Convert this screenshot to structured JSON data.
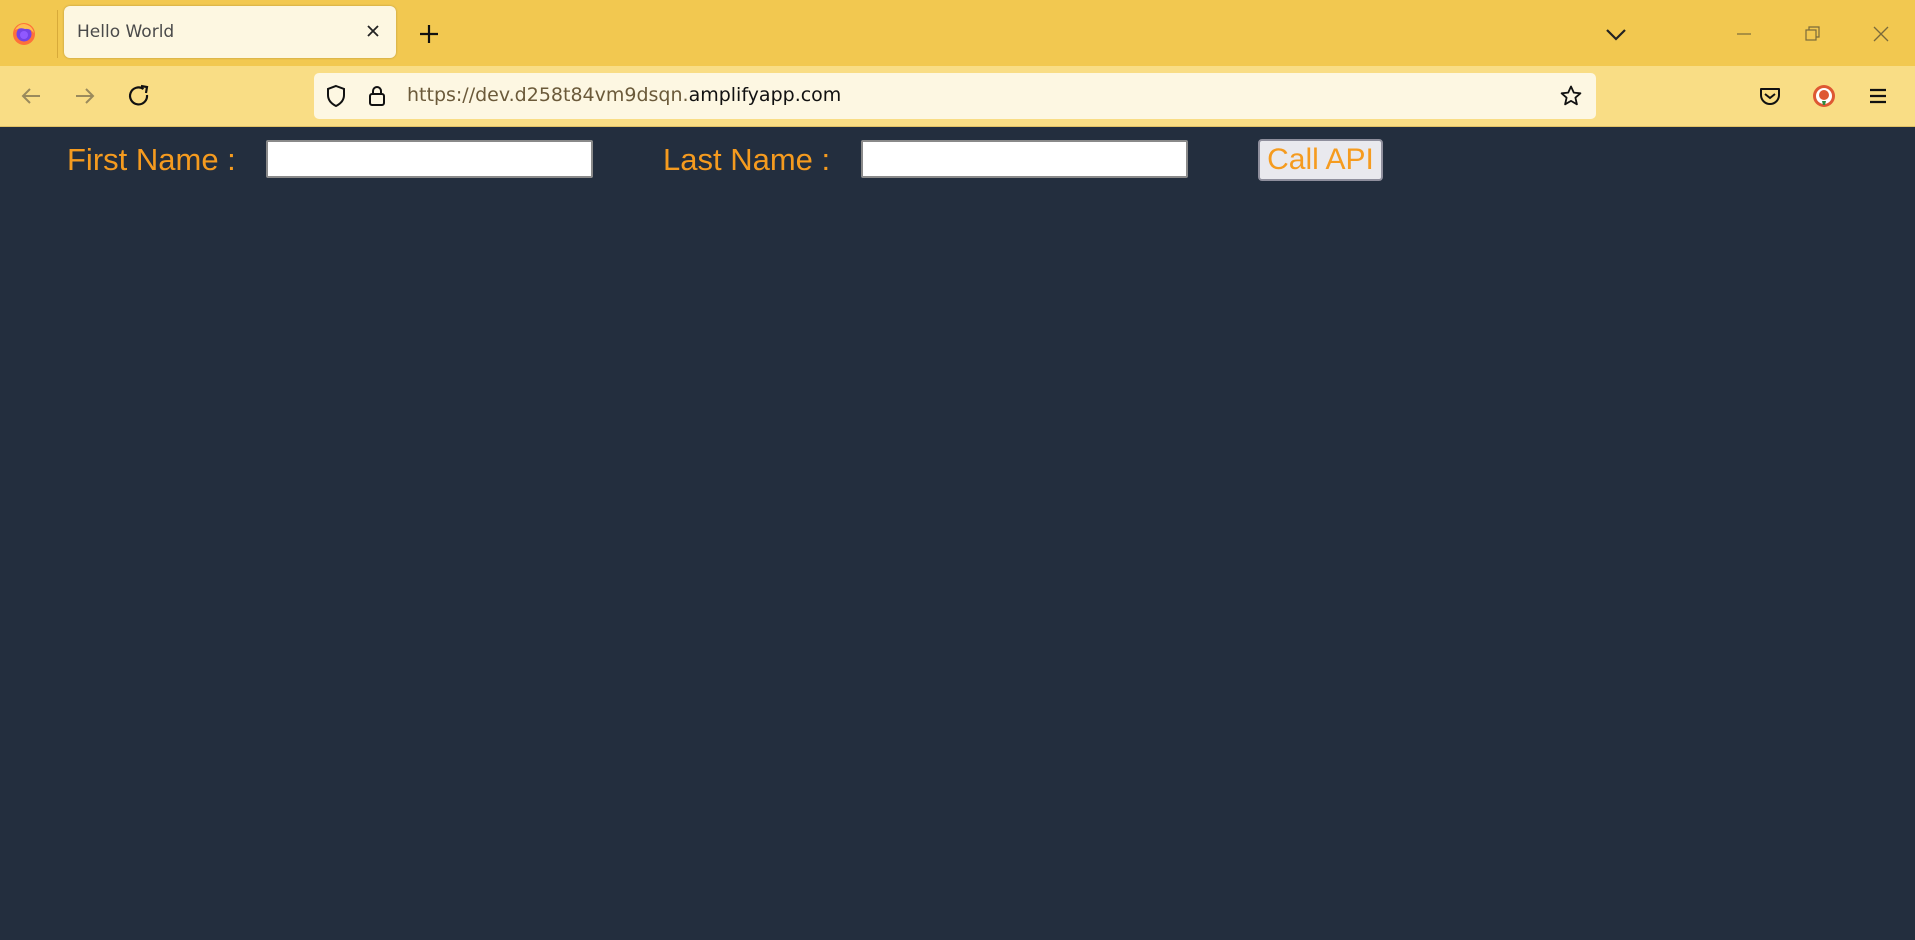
{
  "browser": {
    "tab": {
      "title": "Hello World"
    },
    "address_bar": {
      "url_prefix": "https://dev.d258t84vm9dsqn.",
      "url_host": "amplifyapp.com"
    },
    "colors": {
      "tabstrip": "#f2c850",
      "toolbar": "#f9dd85",
      "urlbar": "#fdf7e2"
    }
  },
  "page": {
    "first_name_label": "First Name :",
    "first_name_value": "",
    "last_name_label": "Last Name :",
    "last_name_value": "",
    "call_button_label": "Call API",
    "colors": {
      "background": "#232e3e",
      "accent": "#f59b1f"
    }
  }
}
